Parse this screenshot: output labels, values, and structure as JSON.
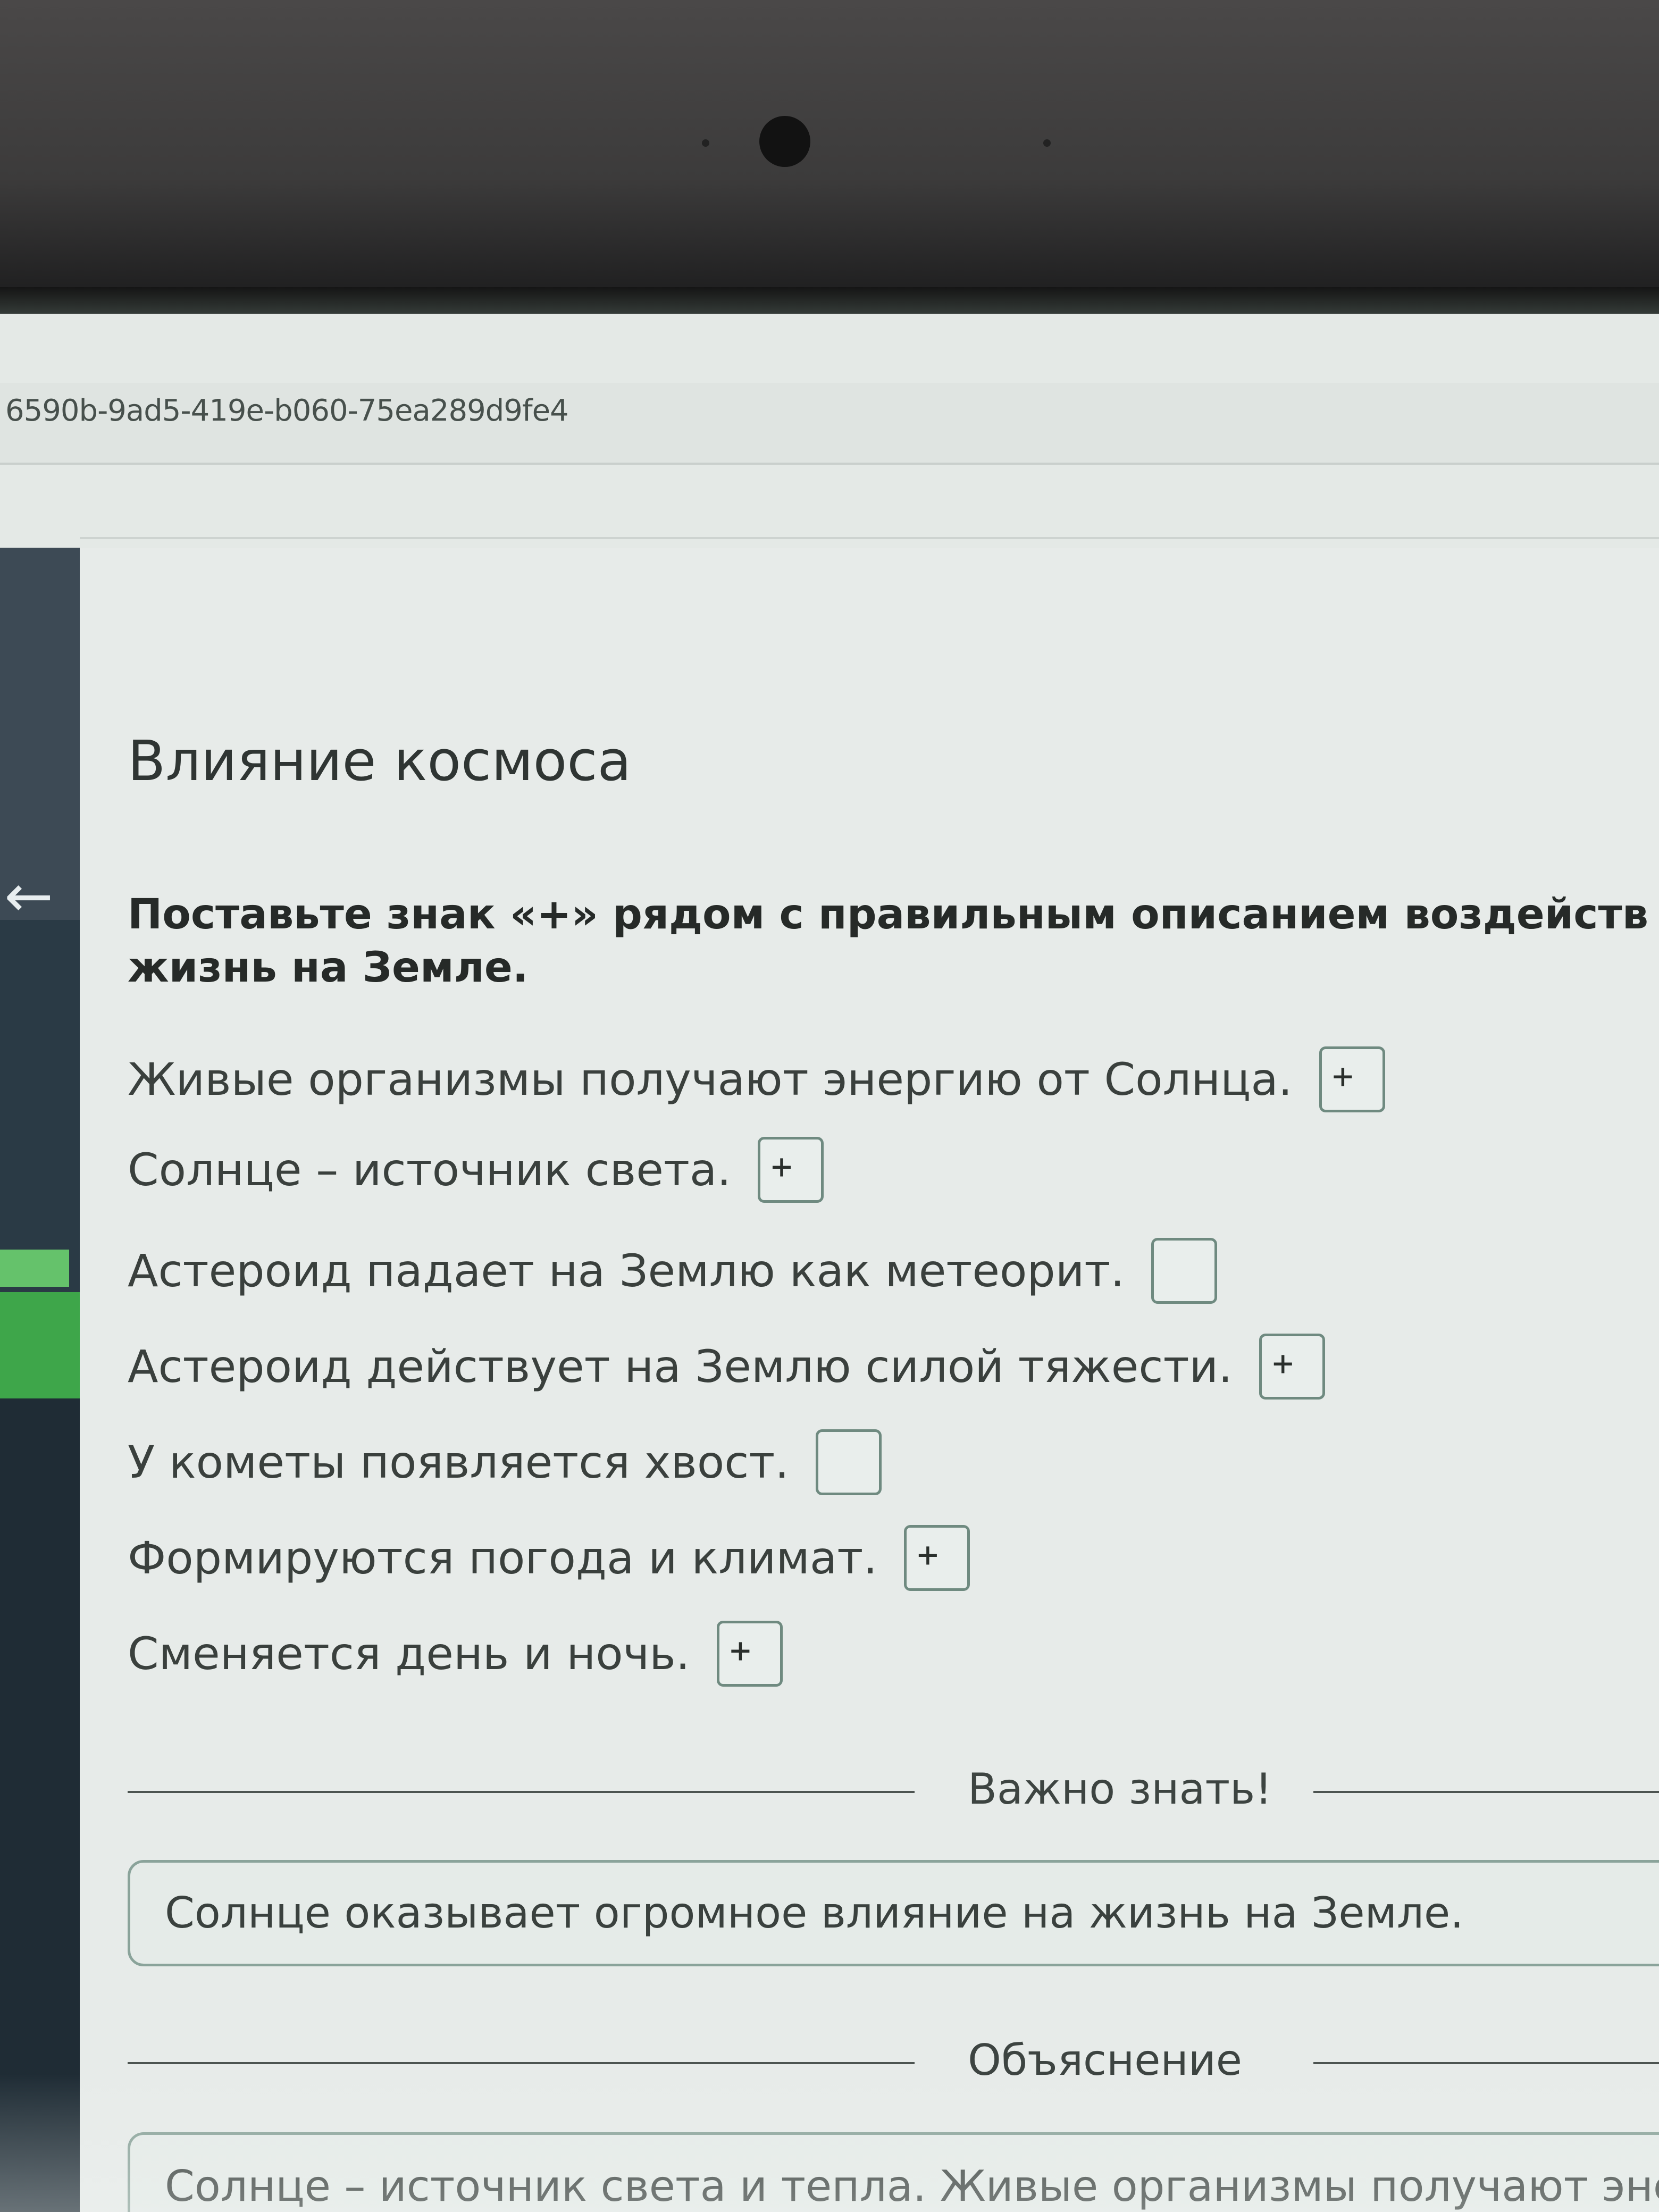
{
  "browser": {
    "url_fragment": "6590b-9ad5-419e-b060-75ea289d9fe4"
  },
  "sidebar": {
    "back_icon": "arrow-left-icon",
    "collapse_icon": "chevron-up-icon"
  },
  "lesson": {
    "title": "Влияние космоса",
    "instruction_line1": "Поставьте знак «+» рядом с правильным описанием воздейств",
    "instruction_line2": "жизнь на Земле.",
    "answers": [
      {
        "text": "Живые организмы получают энергию от Солнца.",
        "value": "+"
      },
      {
        "text": "Солнце – источник света.",
        "value": "+"
      },
      {
        "text": "Астероид падает на Землю как метеорит.",
        "value": ""
      },
      {
        "text": "Астероид действует на Землю силой тяжести.",
        "value": "+"
      },
      {
        "text": "У кометы появляется хвост.",
        "value": ""
      },
      {
        "text": "Формируются погода и климат.",
        "value": "+"
      },
      {
        "text": "Сменяется день и ночь.",
        "value": "+"
      }
    ],
    "important_label": "Важно знать!",
    "important_text": "Солнце оказывает огромное влияние на жизнь на Земле.",
    "explanation_label": "Объяснение",
    "explanation_text": "Солнце – источник света и тепла. Живые организмы получают энерг"
  },
  "colors": {
    "accent_green": "#3ea64a",
    "sidebar_dark": "#2a3a45",
    "box_border": "#6f8a80"
  }
}
